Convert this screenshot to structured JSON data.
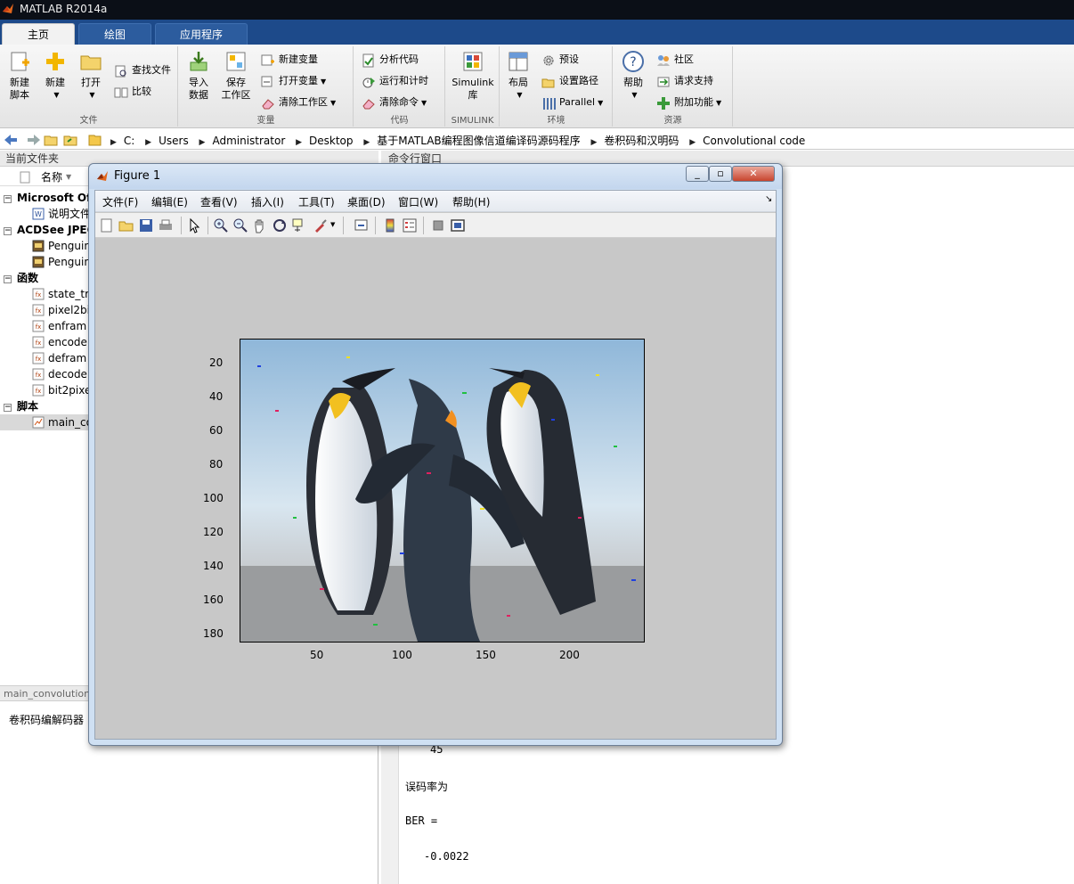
{
  "window": {
    "title": "MATLAB R2014a"
  },
  "ribbon": {
    "tabs": [
      {
        "label": "主页",
        "active": true
      },
      {
        "label": "绘图",
        "active": false
      },
      {
        "label": "应用程序",
        "active": false
      }
    ],
    "groups": {
      "file": {
        "label": "文件",
        "new_script": "新建\n脚本",
        "new": "新建",
        "open": "打开",
        "find_files": "查找文件",
        "compare": "比较"
      },
      "variable": {
        "label": "变量",
        "import": "导入\n数据",
        "save_ws": "保存\n工作区",
        "new_var": "新建变量",
        "open_var": "打开变量",
        "clear_ws": "清除工作区"
      },
      "code": {
        "label": "代码",
        "analyze": "分析代码",
        "run_time": "运行和计时",
        "clear_cmd": "清除命令"
      },
      "simulink": {
        "label": "SIMULINK",
        "lib": "Simulink\n库"
      },
      "env": {
        "label": "环境",
        "layout": "布局",
        "prefs": "预设",
        "set_path": "设置路径",
        "parallel": "Parallel"
      },
      "resources": {
        "label": "资源",
        "help": "帮助",
        "community": "社区",
        "support": "请求支持",
        "addons": "附加功能"
      }
    }
  },
  "address": {
    "crumbs": [
      "C:",
      "Users",
      "Administrator",
      "Desktop",
      "基于MATLAB编程图像信道编译码源码程序",
      "卷积码和汉明码",
      "Convolutional code"
    ]
  },
  "current_folder": {
    "title": "当前文件夹",
    "column_name": "名称",
    "groups": [
      {
        "name": "Microsoft Of",
        "items": [
          "说明文件"
        ]
      },
      {
        "name": "ACDSee JPEG",
        "items": [
          "Penguin",
          "Penguin"
        ]
      },
      {
        "name": "函数",
        "items": [
          "state_tr",
          "pixel2bi",
          "enfram",
          "encode",
          "defram",
          "decode",
          "bit2pixe"
        ]
      },
      {
        "name": "脚本",
        "items": [
          "main_co"
        ]
      }
    ],
    "detail_title": "main_convolution",
    "detail_text": "卷积码编解码器"
  },
  "command_window": {
    "title": "命令行窗口",
    "lines": [
      "45",
      "误码率为",
      "BER =",
      "-0.0022"
    ]
  },
  "figure": {
    "title": "Figure 1",
    "menu": [
      "文件(F)",
      "编辑(E)",
      "查看(V)",
      "插入(I)",
      "工具(T)",
      "桌面(D)",
      "窗口(W)",
      "帮助(H)"
    ],
    "yticks": [
      "20",
      "40",
      "60",
      "80",
      "100",
      "120",
      "140",
      "160",
      "180"
    ],
    "xticks": [
      "50",
      "100",
      "150",
      "200"
    ],
    "image_desc_icon": "penguins-image"
  },
  "colors": {
    "ribbon_tab": "#1d4a8a",
    "figure_bg": "#c8c8c8"
  }
}
